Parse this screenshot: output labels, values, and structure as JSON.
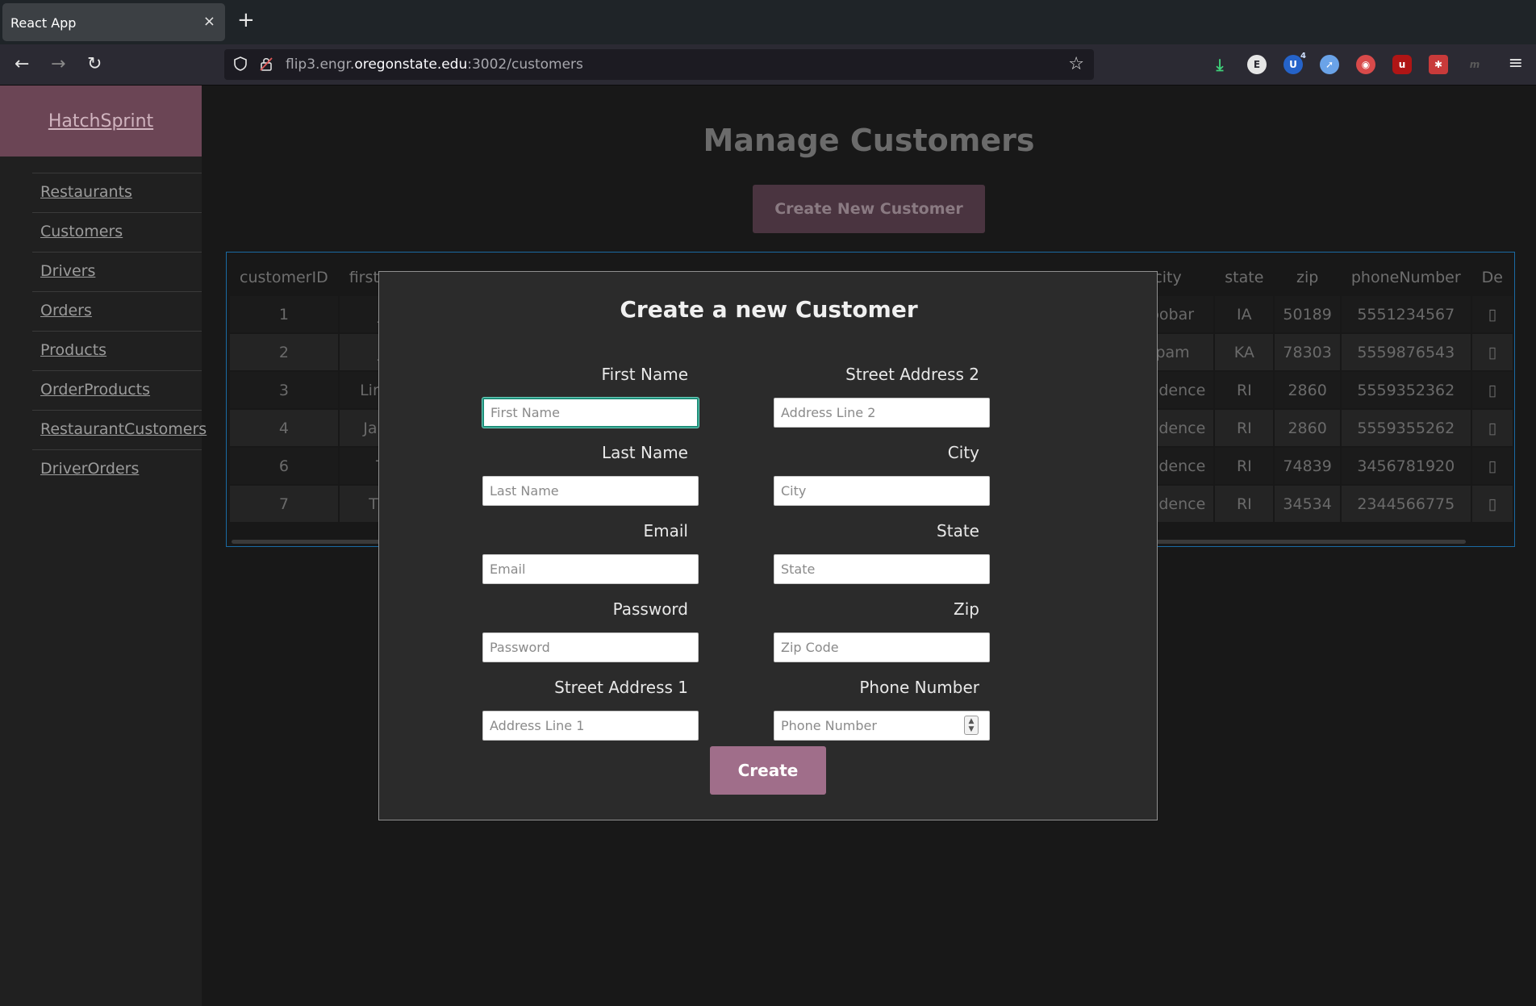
{
  "browser": {
    "tab_title": "React App",
    "tab_close": "×",
    "new_tab": "+",
    "back": "←",
    "forward": "→",
    "reload": "↻",
    "url_host_pre": "flip3.engr.",
    "url_host": "oregonstate.edu",
    "url_rest": ":3002/customers",
    "star": "☆",
    "menu": "≡",
    "extension_badge": "4"
  },
  "sidebar": {
    "brand": "HatchSprint",
    "items": [
      {
        "label": "Restaurants"
      },
      {
        "label": "Customers"
      },
      {
        "label": "Drivers"
      },
      {
        "label": "Orders"
      },
      {
        "label": "Products"
      },
      {
        "label": "OrderProducts"
      },
      {
        "label": "RestaurantCustomers"
      },
      {
        "label": "DriverOrders"
      }
    ]
  },
  "main": {
    "title": "Manage Customers",
    "create_button": "Create New Customer"
  },
  "table": {
    "columns_left": [
      "customerID",
      "firstN"
    ],
    "columns_right": [
      "city",
      "state",
      "zip",
      "phoneNumber",
      "De"
    ],
    "rows": [
      {
        "id": "1",
        "first": "Jo",
        "city": "Foobar",
        "state": "IA",
        "zip": "50189",
        "phone": "5551234567"
      },
      {
        "id": "2",
        "first": "Ja",
        "city": "Spam",
        "state": "KA",
        "zip": "78303",
        "phone": "5559876543"
      },
      {
        "id": "3",
        "first": "Lind",
        "city": "rovidence",
        "state": "RI",
        "zip": "2860",
        "phone": "5559352362"
      },
      {
        "id": "4",
        "first": "Jam",
        "city": "rovidence",
        "state": "RI",
        "zip": "2860",
        "phone": "5559355262"
      },
      {
        "id": "6",
        "first": "Te",
        "city": "rovidence",
        "state": "RI",
        "zip": "74839",
        "phone": "3456781920"
      },
      {
        "id": "7",
        "first": "Thi",
        "city": "rovidence",
        "state": "RI",
        "zip": "34534",
        "phone": "2344566775"
      }
    ]
  },
  "modal": {
    "title": "Create a new Customer",
    "fields": {
      "first_name": {
        "label": "First Name",
        "placeholder": "First Name"
      },
      "last_name": {
        "label": "Last Name",
        "placeholder": "Last Name"
      },
      "email": {
        "label": "Email",
        "placeholder": "Email"
      },
      "password": {
        "label": "Password",
        "placeholder": "Password"
      },
      "street1": {
        "label": "Street Address 1",
        "placeholder": "Address Line 1"
      },
      "street2": {
        "label": "Street Address 2",
        "placeholder": "Address Line 2"
      },
      "city": {
        "label": "City",
        "placeholder": "City"
      },
      "state": {
        "label": "State",
        "placeholder": "State"
      },
      "zip": {
        "label": "Zip",
        "placeholder": "Zip Code"
      },
      "phone": {
        "label": "Phone Number",
        "placeholder": "Phone Number"
      }
    },
    "submit": "Create"
  },
  "colors": {
    "brand": "#6b4555",
    "accent_button": "#a06e8a",
    "focus_ring": "#1f8f7a",
    "table_border": "#1a6aa3"
  }
}
